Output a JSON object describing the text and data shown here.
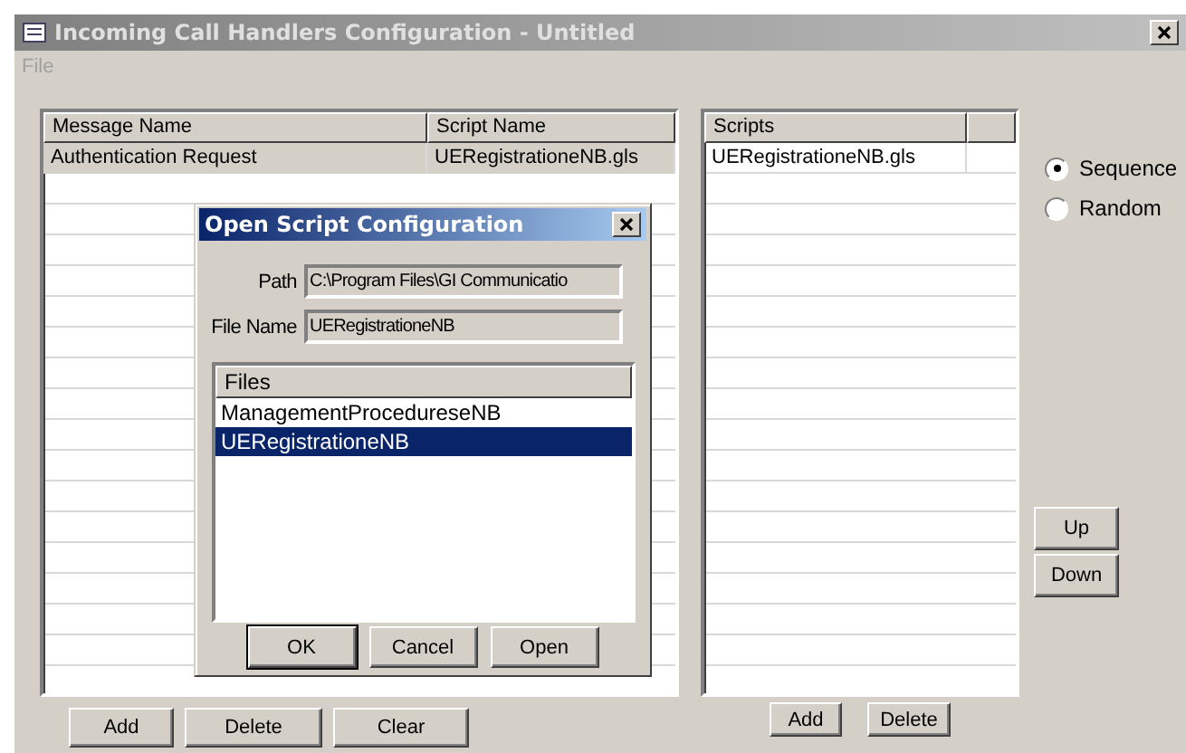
{
  "window": {
    "title": "Incoming Call Handlers Configuration - Untitled"
  },
  "menu": [
    "File"
  ],
  "messages_table": {
    "columns": [
      "Message Name",
      "Script Name"
    ],
    "rows": [
      {
        "cells": [
          "Authentication Request",
          "UERegistrationeNB.gls"
        ],
        "selected": false
      }
    ]
  },
  "message_buttons": [
    "Add",
    "Delete",
    "Clear"
  ],
  "scripts_table": {
    "columns": [
      "Scripts"
    ],
    "rows": [
      {
        "cells": [
          "UERegistrationeNB.gls"
        ],
        "selected": false
      }
    ]
  },
  "script_buttons": [
    "Add",
    "Delete"
  ],
  "order": [
    {
      "label": "Sequence",
      "selected": true
    },
    {
      "label": "Random",
      "selected": false
    }
  ],
  "move_buttons": [
    "Up",
    "Down"
  ],
  "dialog": {
    "title": "Open Script Configuration",
    "path_label": "Path",
    "path": "C:\\Program Files\\GI Communicatio",
    "file_name_label": "File Name",
    "file_name": "UERegistrationeNB",
    "files_header": "Files",
    "files": [
      {
        "name": "ManagementProcedureseNB",
        "selected": false
      },
      {
        "name": "UERegistrationeNB",
        "selected": true
      }
    ],
    "buttons": [
      "OK",
      "Cancel",
      "Open"
    ]
  }
}
